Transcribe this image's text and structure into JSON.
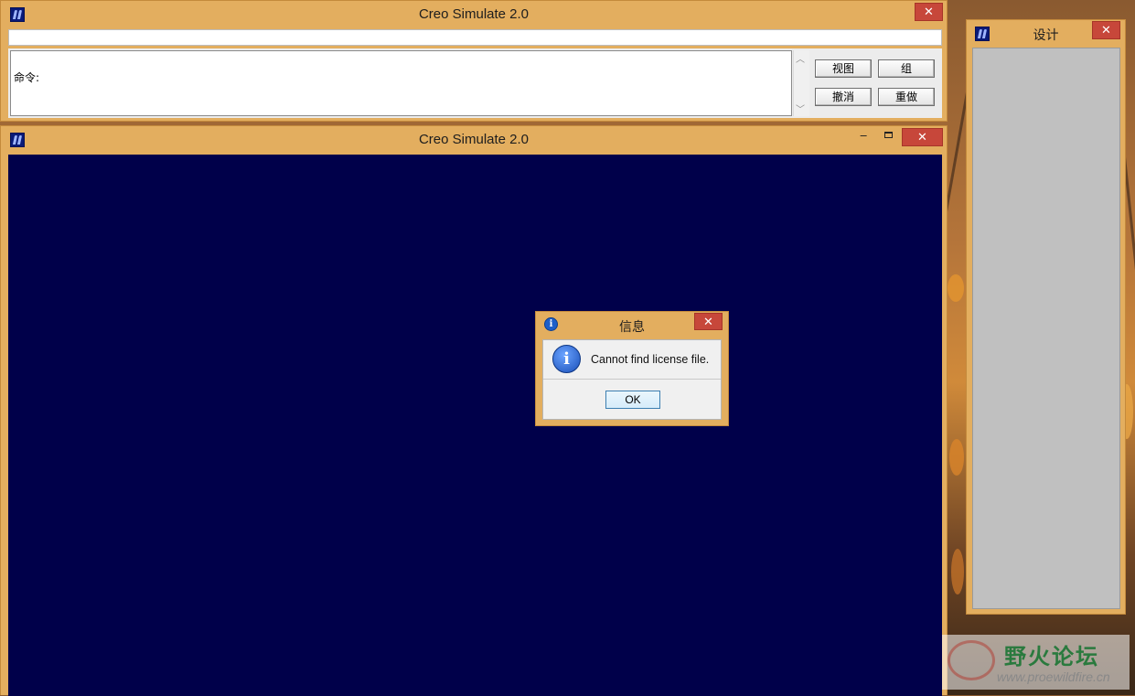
{
  "top_window": {
    "title": "Creo Simulate 2.0",
    "close_glyph": "✕",
    "command_prompt": "命令:",
    "buttons": {
      "view": "视图",
      "group": "组",
      "undo": "撤消",
      "redo": "重做"
    },
    "scroll_up_glyph": "︿",
    "scroll_down_glyph": "﹀"
  },
  "main_window": {
    "title": "Creo Simulate 2.0",
    "minimize_glyph": "‒",
    "maximize_glyph": "▫",
    "close_glyph": "✕",
    "canvas_color": "#00004a"
  },
  "design_panel": {
    "title": "设计",
    "close_glyph": "✕"
  },
  "info_dialog": {
    "title": "信息",
    "close_glyph": "✕",
    "message": "Cannot find license file.",
    "ok_label": "OK",
    "info_glyph": "i"
  },
  "watermark": {
    "brand": "野火论坛",
    "url": "www.proewildfire.cn"
  },
  "colors": {
    "window_frame": "#e3ae5f",
    "close_button": "#c7473a",
    "canvas": "#00004a",
    "panel_body": "#c0c0c0"
  }
}
